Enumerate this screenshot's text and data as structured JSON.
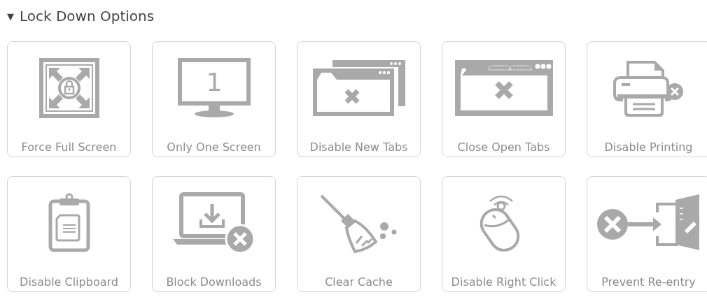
{
  "section": {
    "toggle": "▼",
    "title": "Lock Down Options",
    "expanded": true
  },
  "options": [
    {
      "label": "Force Full Screen"
    },
    {
      "label": "Only One Screen",
      "icon_text": "1"
    },
    {
      "label": "Disable New Tabs"
    },
    {
      "label": "Close Open Tabs"
    },
    {
      "label": "Disable Printing"
    },
    {
      "label": "Disable Clipboard"
    },
    {
      "label": "Block Downloads"
    },
    {
      "label": "Clear Cache"
    },
    {
      "label": "Disable Right Click"
    },
    {
      "label": "Prevent Re-entry"
    }
  ]
}
